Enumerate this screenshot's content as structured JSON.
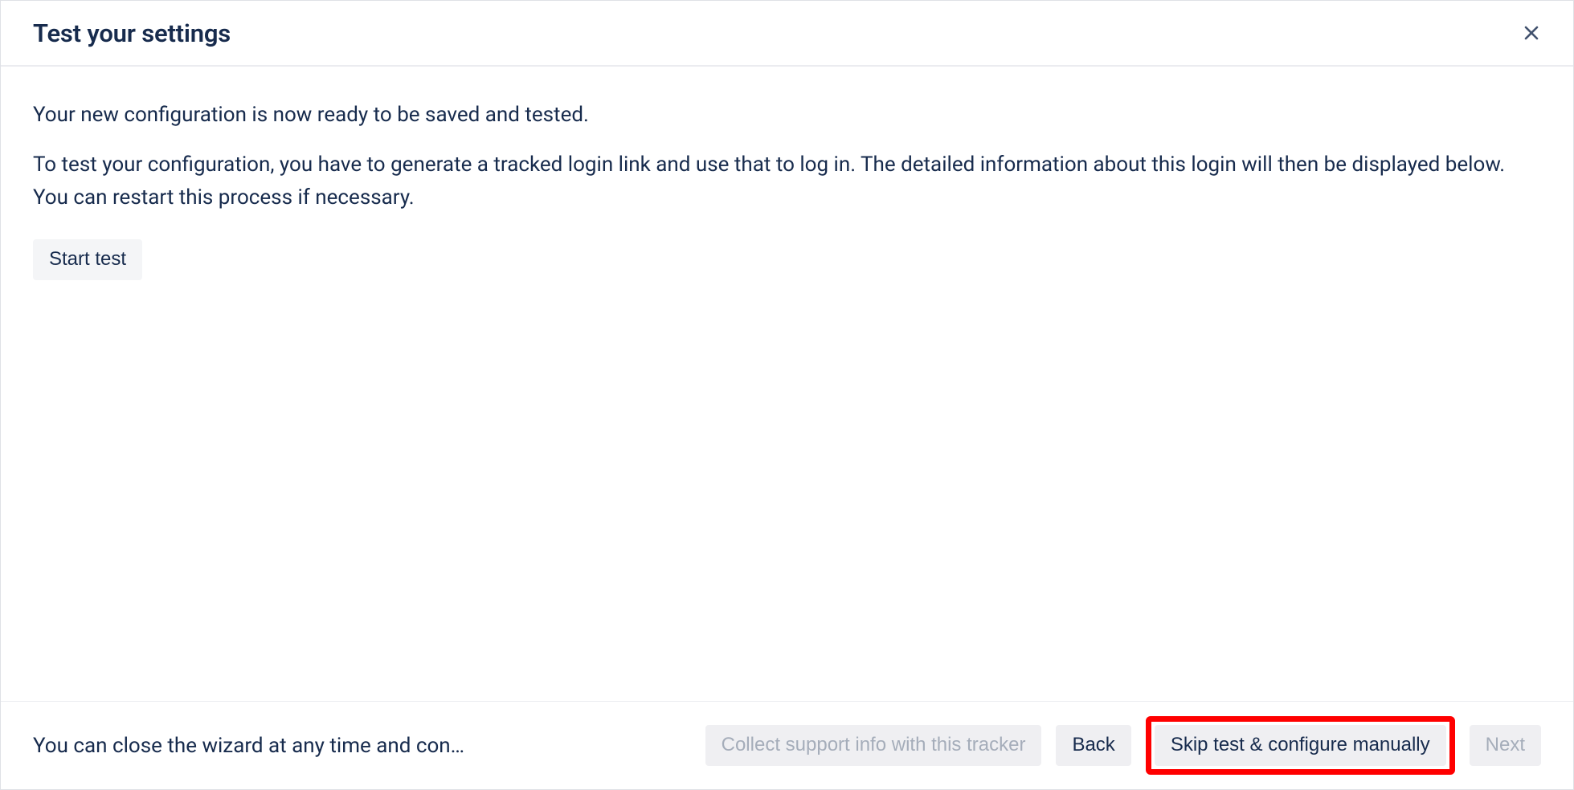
{
  "header": {
    "title": "Test your settings",
    "close_label": "Close"
  },
  "body": {
    "intro_1": "Your new configuration is now ready to be saved and tested.",
    "intro_2": "To test your configuration, you have to generate a tracked login link and use that to log in. The detailed information about this login will then be displayed below. You can restart this process if necessary.",
    "start_test_label": "Start test"
  },
  "footer": {
    "hint": "You can close the wizard at any time and con…",
    "collect_support_label": "Collect support info with this tracker",
    "back_label": "Back",
    "skip_label": "Skip test & configure manually",
    "next_label": "Next"
  }
}
